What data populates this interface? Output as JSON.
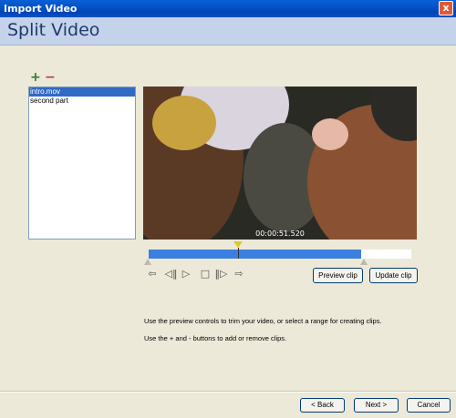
{
  "window": {
    "title": "Import Video",
    "close_glyph": "x"
  },
  "header": {
    "heading": "Split Video"
  },
  "clip_tools": {
    "add_icon": "+",
    "remove_icon": "−"
  },
  "clips": [
    {
      "label": "intro.mov",
      "selected": true
    },
    {
      "label": "second part",
      "selected": false
    }
  ],
  "preview": {
    "timecode": "00:00:51.520",
    "playhead_fraction": 0.34,
    "range_end_fraction": 0.81
  },
  "playback": {
    "jump_start_icon": "⇦",
    "step_back_icon": "◁‖",
    "play_icon": "▷",
    "stop_icon": "□",
    "step_forward_icon": "‖▷",
    "jump_end_icon": "⇨"
  },
  "buttons": {
    "preview_clip": "Preview clip",
    "update_clip": "Update clip",
    "back": "< Back",
    "next": "Next >",
    "cancel": "Cancel"
  },
  "instructions": {
    "line1": "Use the preview controls to trim your video, or select a range for creating clips.",
    "line2": "Use the + and - buttons to add or remove clips."
  }
}
